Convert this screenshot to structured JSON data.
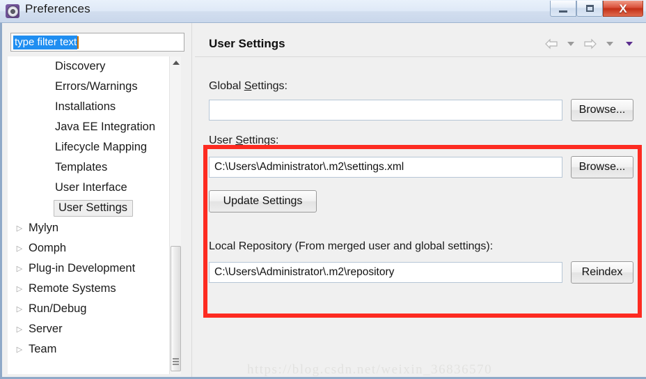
{
  "window": {
    "title": "Preferences",
    "icon": "preferences-gear-icon",
    "minimize_label": "",
    "maximize_label": "",
    "close_label": "X"
  },
  "sidebar": {
    "filter": {
      "value": "type filter text",
      "placeholder": "type filter text"
    },
    "items": [
      {
        "label": "Discovery",
        "type": "child",
        "expander": "",
        "selected": false
      },
      {
        "label": "Errors/Warnings",
        "type": "child",
        "expander": "",
        "selected": false
      },
      {
        "label": "Installations",
        "type": "child",
        "expander": "",
        "selected": false
      },
      {
        "label": "Java EE Integration",
        "type": "child",
        "expander": "",
        "selected": false
      },
      {
        "label": "Lifecycle Mapping",
        "type": "child",
        "expander": "",
        "selected": false
      },
      {
        "label": "Templates",
        "type": "child",
        "expander": "",
        "selected": false
      },
      {
        "label": "User Interface",
        "type": "child",
        "expander": "",
        "selected": false
      },
      {
        "label": "User Settings",
        "type": "child",
        "expander": "",
        "selected": true
      },
      {
        "label": "Mylyn",
        "type": "parent",
        "expander": "▷",
        "selected": false
      },
      {
        "label": "Oomph",
        "type": "parent",
        "expander": "▷",
        "selected": false
      },
      {
        "label": "Plug-in Development",
        "type": "parent",
        "expander": "▷",
        "selected": false
      },
      {
        "label": "Remote Systems",
        "type": "parent",
        "expander": "▷",
        "selected": false
      },
      {
        "label": "Run/Debug",
        "type": "parent",
        "expander": "▷",
        "selected": false
      },
      {
        "label": "Server",
        "type": "parent",
        "expander": "▷",
        "selected": false
      },
      {
        "label": "Team",
        "type": "parent",
        "expander": "▷",
        "selected": false
      }
    ]
  },
  "page": {
    "title": "User Settings",
    "nav": {
      "back_icon": "back-arrow-icon",
      "back_menu_icon": "chevron-down-icon",
      "forward_icon": "forward-arrow-icon",
      "forward_menu_icon": "chevron-down-icon",
      "view_menu_icon": "chevron-down-icon"
    },
    "global_settings": {
      "label_pre": "Global ",
      "label_mnemonic": "S",
      "label_post": "ettings:",
      "value": "",
      "browse_label": "Browse..."
    },
    "user_settings": {
      "label_pre": "User ",
      "label_mnemonic": "S",
      "label_post": "ettings:",
      "value": "C:\\Users\\Administrator\\.m2\\settings.xml",
      "browse_label": "Browse...",
      "update_label": "Update Settings"
    },
    "local_repository": {
      "label": "Local Repository (From merged user and global settings):",
      "value": "C:\\Users\\Administrator\\.m2\\repository",
      "reindex_label": "Reindex"
    }
  },
  "annotation": {
    "highlight_color": "#fd2b21"
  },
  "watermark": {
    "text": "https://blog.csdn.net/weixin_36836570"
  }
}
